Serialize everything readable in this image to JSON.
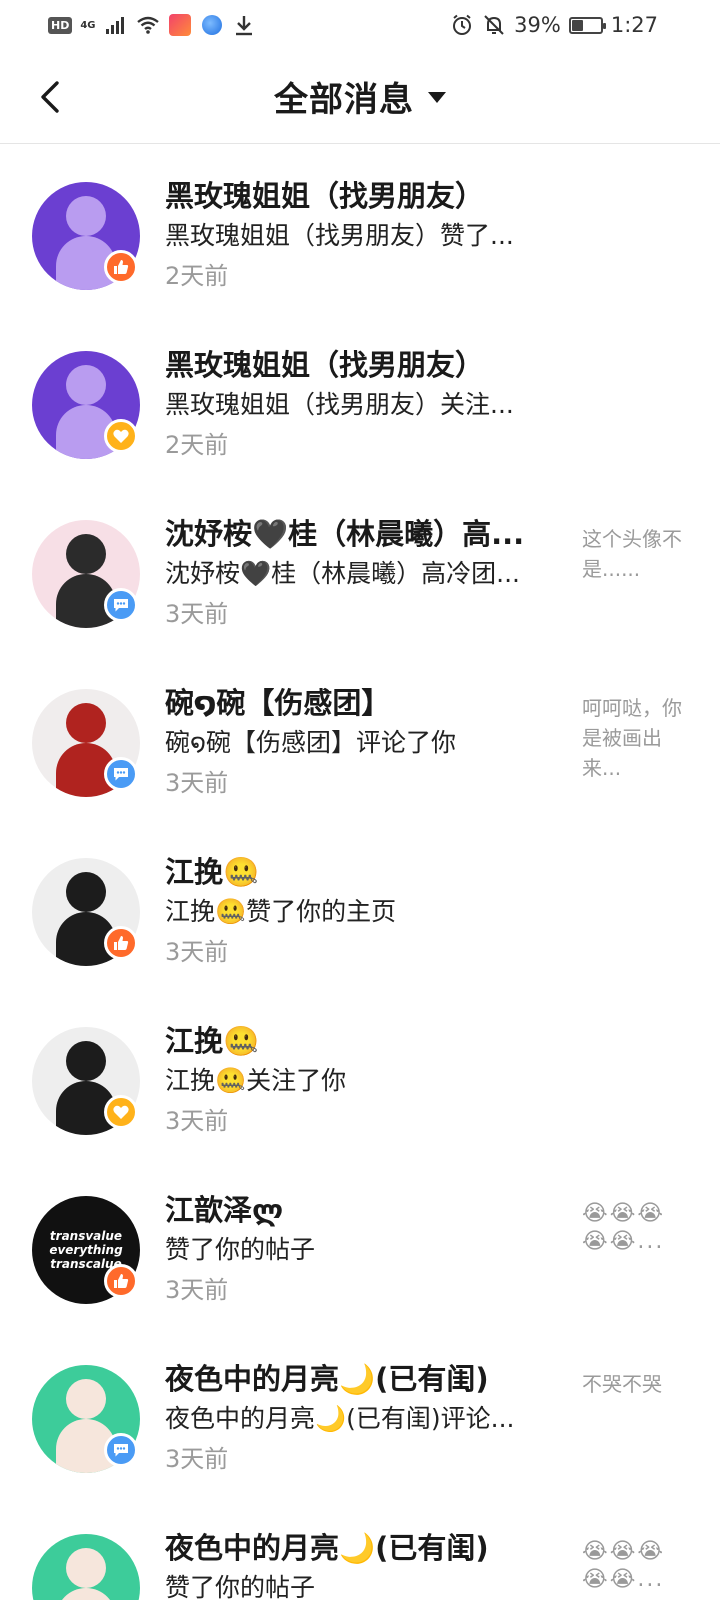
{
  "status_bar": {
    "hd": "HD",
    "network": "4G",
    "battery_text": "39%",
    "battery_level": 0.39,
    "time": "1:27"
  },
  "header": {
    "title": "全部消息"
  },
  "notifications": [
    {
      "name": "黑玫瑰姐姐（找男朋友）",
      "action": "黑玫瑰姐姐（找男朋友）赞了...",
      "time": "2天前",
      "preview": "",
      "badge": "like",
      "avatar_colors": [
        "#6b3fd1",
        "#b99cf0"
      ]
    },
    {
      "name": "黑玫瑰姐姐（找男朋友）",
      "action": "黑玫瑰姐姐（找男朋友）关注...",
      "time": "2天前",
      "preview": "",
      "badge": "follow",
      "avatar_colors": [
        "#6b3fd1",
        "#b99cf0"
      ]
    },
    {
      "name": "沈妤桉🖤桂（林晨曦）高...",
      "action": "沈妤桉🖤桂（林晨曦）高冷团...",
      "time": "3天前",
      "preview": "这个头像不是......",
      "badge": "comment",
      "avatar_colors": [
        "#f7dfe6",
        "#2b2b2b"
      ]
    },
    {
      "name": "碗໑碗【伤感团】",
      "action": "碗໑碗【伤感团】评论了你",
      "time": "3天前",
      "preview": "呵呵哒，你是被画出来...",
      "badge": "comment",
      "avatar_colors": [
        "#f0eded",
        "#b0231f"
      ]
    },
    {
      "name": "江挽🤐",
      "action": "江挽🤐赞了你的主页",
      "time": "3天前",
      "preview": "",
      "badge": "like",
      "avatar_colors": [
        "#eeeeee",
        "#1c1c1c"
      ]
    },
    {
      "name": "江挽🤐",
      "action": "江挽🤐关注了你",
      "time": "3天前",
      "preview": "",
      "badge": "follow",
      "avatar_colors": [
        "#eeeeee",
        "#1c1c1c"
      ]
    },
    {
      "name": "江歆泽ლ",
      "action": "赞了你的帖子",
      "time": "3天前",
      "preview": "😭😭😭😭😭...",
      "badge": "like",
      "avatar_colors": [
        "#111111",
        "#ffffff"
      ],
      "avatar_text": "transvalue everything transcalue"
    },
    {
      "name": "夜色中的月亮🌙(已有闺)",
      "action": "夜色中的月亮🌙(已有闺)评论...",
      "time": "3天前",
      "preview": "不哭不哭",
      "badge": "comment",
      "avatar_colors": [
        "#3dcc9a",
        "#f6e6dc"
      ]
    },
    {
      "name": "夜色中的月亮🌙(已有闺)",
      "action": "赞了你的帖子",
      "time": "",
      "preview": "😭😭😭😭😭...",
      "badge": "like",
      "avatar_colors": [
        "#3dcc9a",
        "#f6e6dc"
      ]
    }
  ]
}
